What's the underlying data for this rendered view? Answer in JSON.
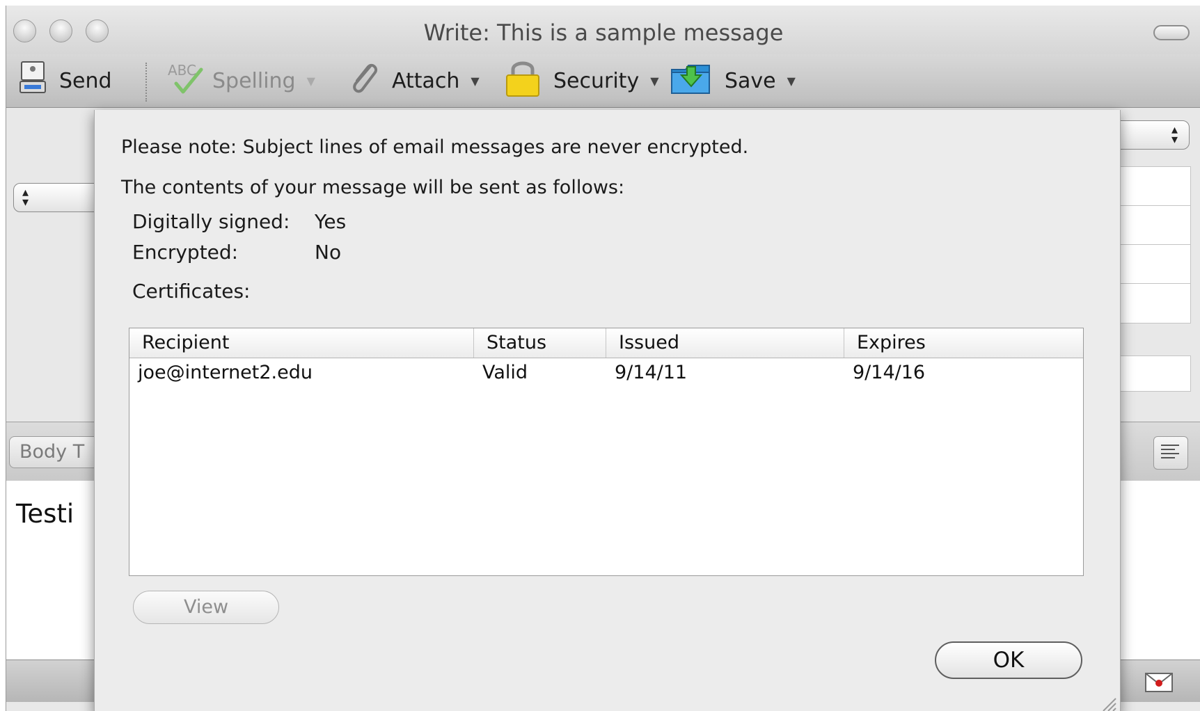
{
  "window": {
    "title": "Write: This is a sample message"
  },
  "toolbar": {
    "items": [
      {
        "label": "Send",
        "icon": "send-icon"
      },
      {
        "label": "Spelling",
        "icon": "spelling-icon",
        "disabled": true
      },
      {
        "label": "Attach",
        "icon": "paperclip-icon"
      },
      {
        "label": "Security",
        "icon": "padlock-icon"
      },
      {
        "label": "Save",
        "icon": "save-icon"
      }
    ]
  },
  "background": {
    "format_select": "Body T",
    "body_text": "Testi"
  },
  "dialog": {
    "note": "Please note: Subject lines of email messages are never encrypted.",
    "intro": "The contents of your message will be sent as follows:",
    "signed_label": "Digitally signed:",
    "signed_value": "Yes",
    "encrypted_label": "Encrypted:",
    "encrypted_value": "No",
    "certificates_label": "Certificates:",
    "table": {
      "columns": [
        "Recipient",
        "Status",
        "Issued",
        "Expires"
      ],
      "rows": [
        [
          "joe@internet2.edu",
          "Valid",
          "9/14/11",
          "9/14/16"
        ]
      ]
    },
    "view_button": "View",
    "ok_button": "OK"
  },
  "colors": {
    "window_bg": "#e8e8e8",
    "sheet_bg": "#ececec",
    "padlock": "#f3d21c",
    "save_icon": "#2b8fd6"
  }
}
